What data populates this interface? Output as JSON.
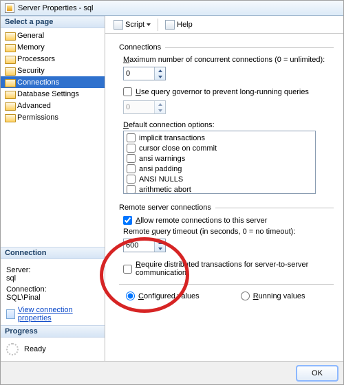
{
  "window": {
    "title": "Server Properties - sql"
  },
  "toolbar": {
    "script": "Script",
    "help": "Help"
  },
  "sidebar": {
    "select_page": "Select a page",
    "items": [
      {
        "label": "General"
      },
      {
        "label": "Memory"
      },
      {
        "label": "Processors"
      },
      {
        "label": "Security"
      },
      {
        "label": "Connections",
        "selected": true
      },
      {
        "label": "Database Settings"
      },
      {
        "label": "Advanced"
      },
      {
        "label": "Permissions"
      }
    ],
    "connection_head": "Connection",
    "server_label": "Server:",
    "server_value": "sql",
    "conn_label": "Connection:",
    "conn_value": "SQL\\Pinal",
    "view_conn_link": "View connection properties",
    "progress_head": "Progress",
    "progress_state": "Ready"
  },
  "main": {
    "connections_group": "Connections",
    "max_conn_label": "Maximum number of concurrent connections (0 = unlimited):",
    "max_conn_value": "0",
    "use_query_governor": "Use query governor to prevent long-running queries",
    "governor_value": "0",
    "default_opts_label": "Default connection options:",
    "opts": [
      "implicit transactions",
      "cursor close on commit",
      "ansi warnings",
      "ansi padding",
      "ANSI NULLS",
      "arithmetic abort"
    ],
    "remote_group": "Remote server connections",
    "allow_remote": "Allow remote connections to this server",
    "allow_remote_checked": true,
    "remote_timeout_label": "Remote query timeout (in seconds, 0 = no timeout):",
    "remote_timeout_value": "600",
    "require_dist": "Require distributed transactions for server-to-server communication",
    "configured": "Configured values",
    "running": "Running values"
  },
  "footer": {
    "ok": "OK"
  }
}
